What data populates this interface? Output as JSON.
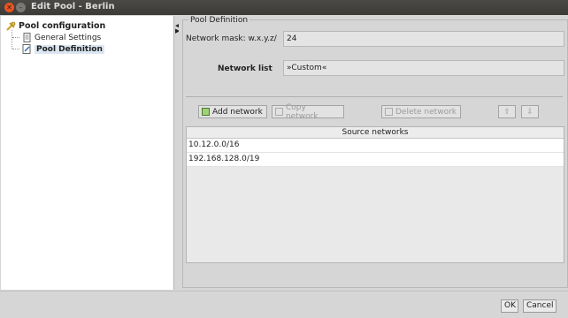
{
  "window": {
    "title": "Edit Pool - Berlin"
  },
  "tree": {
    "root": "Pool configuration",
    "items": [
      {
        "label": "General Settings"
      },
      {
        "label": "Pool Definition",
        "selected": true
      }
    ]
  },
  "section": {
    "title": "Pool Definition"
  },
  "form": {
    "mask_label": "Network mask: w.x.y.z/",
    "mask_value": "24",
    "list_label": "Network list",
    "list_value": "»Custom«"
  },
  "toolbar": {
    "add": "Add network",
    "copy": "Copy network",
    "delete": "Delete network"
  },
  "table": {
    "header": "Source networks",
    "rows": [
      "10.12.0.0/16",
      "192.168.128.0/19"
    ]
  },
  "footer": {
    "ok": "OK",
    "cancel": "Cancel"
  },
  "colors": {
    "close_button": "#e95420",
    "selection": "#dbe6f3",
    "titlebar": "#3c3b37"
  }
}
